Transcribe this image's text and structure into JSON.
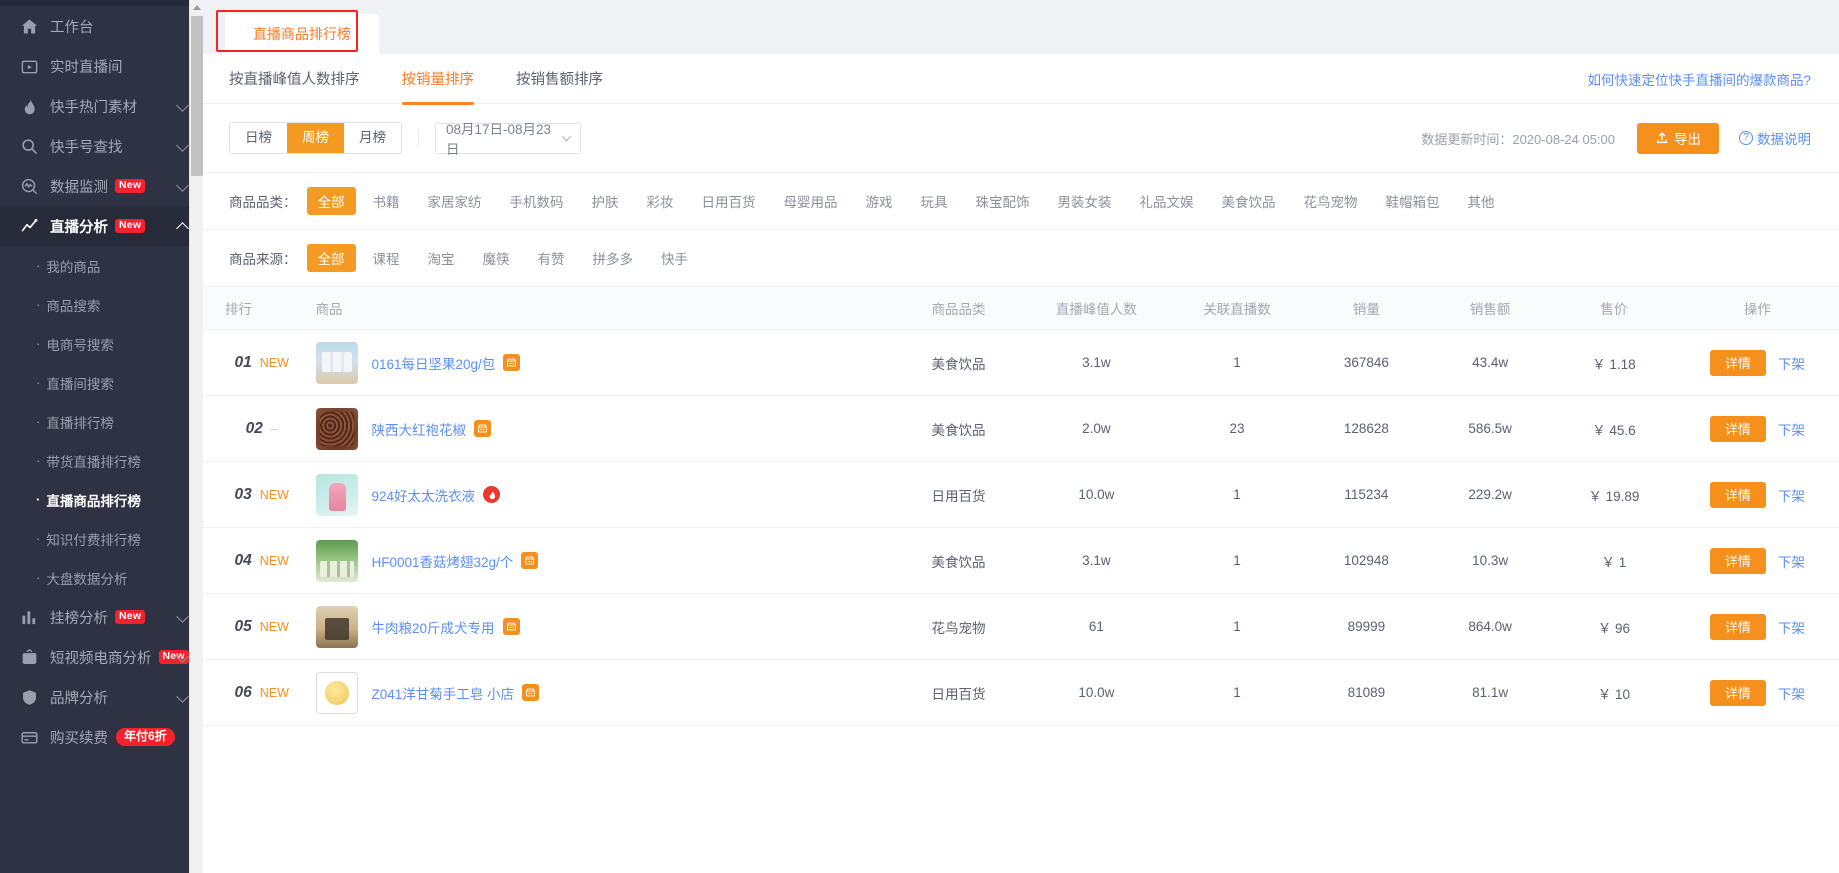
{
  "sidebar": {
    "items": [
      {
        "label": "工作台",
        "icon": "home-icon",
        "chevron": null,
        "badge": null
      },
      {
        "label": "实时直播间",
        "icon": "live-room-icon",
        "chevron": null,
        "badge": null
      },
      {
        "label": "快手热门素材",
        "icon": "fire-icon",
        "chevron": "down",
        "badge": null
      },
      {
        "label": "快手号查找",
        "icon": "search-icon",
        "chevron": "down",
        "badge": null
      },
      {
        "label": "数据监测",
        "icon": "monitor-icon",
        "chevron": "down",
        "badge": "New"
      },
      {
        "label": "直播分析",
        "icon": "chart-line-icon",
        "chevron": "up",
        "badge": "New",
        "open": true
      }
    ],
    "sub_items": [
      {
        "label": "我的商品",
        "active": false
      },
      {
        "label": "商品搜索",
        "active": false
      },
      {
        "label": "电商号搜索",
        "active": false
      },
      {
        "label": "直播间搜索",
        "active": false
      },
      {
        "label": "直播排行榜",
        "active": false
      },
      {
        "label": "带货直播排行榜",
        "active": false
      },
      {
        "label": "直播商品排行榜",
        "active": true
      },
      {
        "label": "知识付费排行榜",
        "active": false
      },
      {
        "label": "大盘数据分析",
        "active": false
      }
    ],
    "bottom_items": [
      {
        "label": "挂榜分析",
        "icon": "bar-chart-icon",
        "chevron": "down",
        "badge": "New"
      },
      {
        "label": "短视频电商分析",
        "icon": "bag-icon",
        "chevron": "down",
        "badge": "New"
      },
      {
        "label": "品牌分析",
        "icon": "shield-icon",
        "chevron": "down",
        "badge": null
      },
      {
        "label": "购买续费",
        "icon": "card-icon",
        "chevron": null,
        "discount": "年付6折"
      }
    ]
  },
  "page_tab": {
    "label": "直播商品排行榜"
  },
  "sort_tabs": [
    {
      "label": "按直播峰值人数排序",
      "active": false
    },
    {
      "label": "按销量排序",
      "active": true
    },
    {
      "label": "按销售额排序",
      "active": false
    }
  ],
  "help_link": "如何快速定位快手直播间的爆款商品?",
  "controls": {
    "period_options": [
      {
        "label": "日榜",
        "active": false
      },
      {
        "label": "周榜",
        "active": true
      },
      {
        "label": "月榜",
        "active": false
      }
    ],
    "date_range": "08月17日-08月23日",
    "update_time_label": "数据更新时间：2020-08-24 05:00",
    "export_label": "导出",
    "export_icon": "upload-icon",
    "data_note_label": "数据说明",
    "data_note_icon": "question-circle-icon"
  },
  "filters": [
    {
      "label": "商品品类：",
      "options": [
        {
          "label": "全部",
          "active": true
        },
        {
          "label": "书籍",
          "active": false
        },
        {
          "label": "家居家纺",
          "active": false
        },
        {
          "label": "手机数码",
          "active": false
        },
        {
          "label": "护肤",
          "active": false
        },
        {
          "label": "彩妆",
          "active": false
        },
        {
          "label": "日用百货",
          "active": false
        },
        {
          "label": "母婴用品",
          "active": false
        },
        {
          "label": "游戏",
          "active": false
        },
        {
          "label": "玩具",
          "active": false
        },
        {
          "label": "珠宝配饰",
          "active": false
        },
        {
          "label": "男装女装",
          "active": false
        },
        {
          "label": "礼品文娱",
          "active": false
        },
        {
          "label": "美食饮品",
          "active": false
        },
        {
          "label": "花鸟宠物",
          "active": false
        },
        {
          "label": "鞋帽箱包",
          "active": false
        },
        {
          "label": "其他",
          "active": false
        }
      ]
    },
    {
      "label": "商品来源：",
      "options": [
        {
          "label": "全部",
          "active": true
        },
        {
          "label": "课程",
          "active": false
        },
        {
          "label": "淘宝",
          "active": false
        },
        {
          "label": "魔筷",
          "active": false
        },
        {
          "label": "有赞",
          "active": false
        },
        {
          "label": "拼多多",
          "active": false
        },
        {
          "label": "快手",
          "active": false
        }
      ]
    }
  ],
  "table": {
    "columns": [
      "排行",
      "商品",
      "商品品类",
      "直播峰值人数",
      "关联直播数",
      "销量",
      "销售额",
      "售价",
      "操作"
    ],
    "rows": [
      {
        "rank": "01",
        "tag": "NEW",
        "thumb": "img-nuts",
        "name": "0161每日坚果20g/包",
        "src_icon": "shop-icon",
        "category": "美食饮品",
        "peak_viewers": "3.1w",
        "live_count": "1",
        "sales": "367846",
        "gmv": "43.4w",
        "price": "￥ 1.18",
        "detail_label": "详情",
        "off_label": "下架"
      },
      {
        "rank": "02",
        "tag": "–",
        "thumb": "img-pepper",
        "name": "陕西大红袍花椒",
        "src_icon": "shop-icon",
        "category": "美食饮品",
        "peak_viewers": "2.0w",
        "live_count": "23",
        "sales": "128628",
        "gmv": "586.5w",
        "price": "￥ 45.6",
        "detail_label": "详情",
        "off_label": "下架"
      },
      {
        "rank": "03",
        "tag": "NEW",
        "thumb": "img-deterg",
        "name": "924好太太洗衣液",
        "src_icon": "fire-icon",
        "category": "日用百货",
        "peak_viewers": "10.0w",
        "live_count": "1",
        "sales": "115234",
        "gmv": "229.2w",
        "price": "￥ 19.89",
        "detail_label": "详情",
        "off_label": "下架"
      },
      {
        "rank": "04",
        "tag": "NEW",
        "thumb": "img-wings",
        "name": "HF0001香菇烤翅32g/个",
        "src_icon": "shop-icon",
        "category": "美食饮品",
        "peak_viewers": "3.1w",
        "live_count": "1",
        "sales": "102948",
        "gmv": "10.3w",
        "price": "￥ 1",
        "detail_label": "详情",
        "off_label": "下架"
      },
      {
        "rank": "05",
        "tag": "NEW",
        "thumb": "img-dog",
        "name": "牛肉粮20斤成犬专用",
        "src_icon": "shop-icon",
        "category": "花鸟宠物",
        "peak_viewers": "61",
        "live_count": "1",
        "sales": "89999",
        "gmv": "864.0w",
        "price": "￥ 96",
        "detail_label": "详情",
        "off_label": "下架"
      },
      {
        "rank": "06",
        "tag": "NEW",
        "thumb": "img-soap",
        "name": "Z041洋甘菊手工皂 小店",
        "src_icon": "shop-icon",
        "category": "日用百货",
        "peak_viewers": "10.0w",
        "live_count": "1",
        "sales": "81089",
        "gmv": "81.1w",
        "price": "￥ 10",
        "detail_label": "详情",
        "off_label": "下架"
      }
    ]
  },
  "colors": {
    "accent_orange": "#f5901d",
    "link_blue": "#5b8ff9",
    "price_red": "#f5593d",
    "sidebar_bg": "#2e3242",
    "badge_red": "#f5222d"
  }
}
